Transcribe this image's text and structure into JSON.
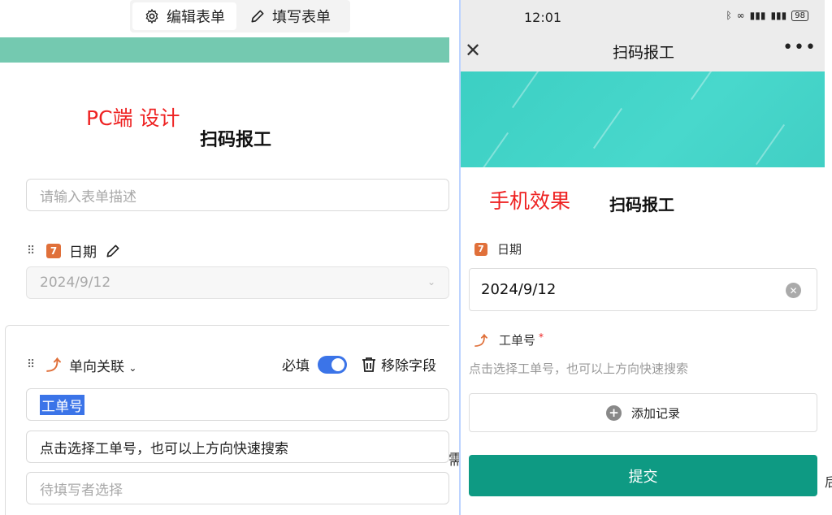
{
  "pc": {
    "mode_tabs": [
      {
        "label": "编辑表单",
        "icon": "gear-icon",
        "active": true
      },
      {
        "label": "填写表单",
        "icon": "pencil-icon",
        "active": false
      }
    ],
    "note": "PC端 设计",
    "form_title": "扫码报工",
    "description_placeholder": "请输入表单描述",
    "date_field": {
      "label": "日期",
      "value": "2024/9/12"
    },
    "link_field": {
      "type_label": "单向关联",
      "required_label": "必填",
      "required": true,
      "remove_label": "移除字段",
      "name": "工单号",
      "hint": "点击选择工单号，也可以上方向快速搜索",
      "default_placeholder": "待填写者选择"
    }
  },
  "phone": {
    "time": "12:01",
    "battery": "98",
    "nav_title": "扫码报工",
    "note": "手机效果",
    "form_title": "扫码报工",
    "date_label": "日期",
    "date_value": "2024/9/12",
    "order_label": "工单号",
    "order_required_mark": "*",
    "order_hint": "点击选择工单号，也可以上方向快速搜索",
    "add_record_label": "添加记录",
    "submit_label": "提交"
  },
  "background_fragments": [
    "需",
    "后"
  ],
  "colors": {
    "accent_green": "#0e9a83",
    "band_green": "#74c9b0",
    "banner_teal": "#48d8cc",
    "note_red": "#ee2222",
    "toggle_blue": "#3b74e8"
  }
}
